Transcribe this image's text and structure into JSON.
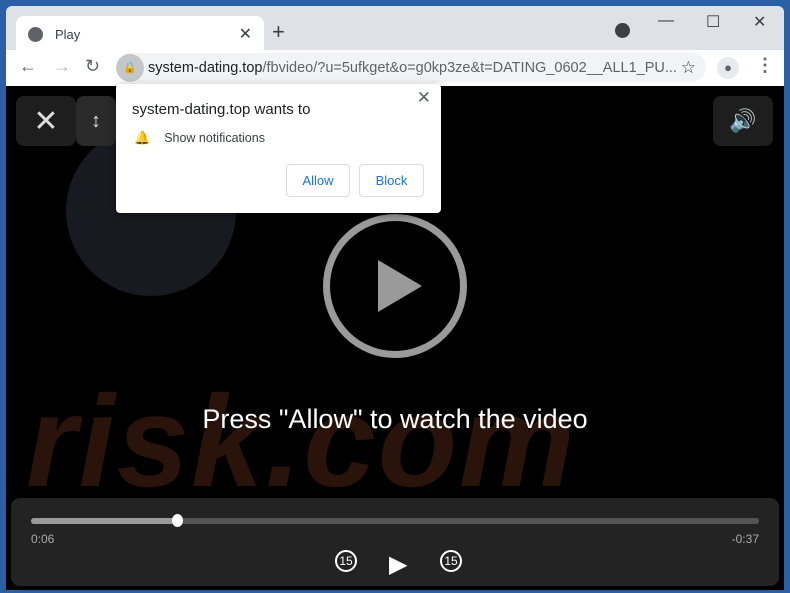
{
  "browser": {
    "tab_title": "Play",
    "url_domain": "system-dating.top",
    "url_path": "/fbvideo/?u=5ufkget&o=g0kp3ze&t=DATING_0602__ALL1_PU..."
  },
  "popup": {
    "title": "system-dating.top wants to",
    "permission": "Show notifications",
    "allow_label": "Allow",
    "block_label": "Block"
  },
  "page": {
    "message": "Press \"Allow\" to watch the video",
    "watermark": "risk.com"
  },
  "player": {
    "elapsed": "0:06",
    "remaining": "-0:37",
    "progress_fraction": 0.2,
    "skip_back": "15",
    "skip_forward": "15"
  }
}
